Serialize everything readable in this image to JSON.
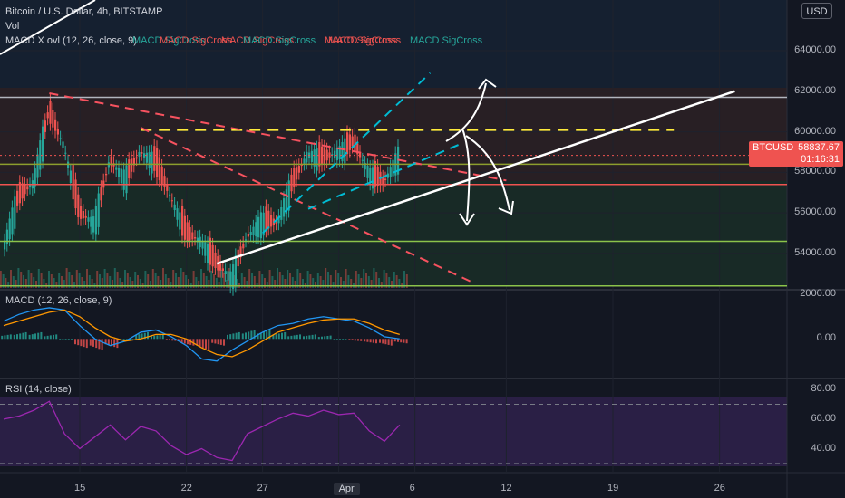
{
  "header": {
    "symbol_title": "Bitcoin / U.S. Dollar, 4h, BITSTAMP",
    "vol_label": "Vol",
    "indicator_label": "MACD X ovl (12, 26, close, 9)",
    "crossover_labels": [
      "MACD SigCross",
      "MACD SigCross",
      "MACD SigCross",
      "MACD SigCross",
      "MACD SigCross",
      "MACD SigCross",
      "MACD SigCross"
    ]
  },
  "currency_button": "USD",
  "price_tag": {
    "symbol": "BTCUSD",
    "price": "58837.67",
    "countdown": "01:16:31"
  },
  "panes": {
    "macd_label": "MACD (12, 26, close, 9)",
    "rsi_label": "RSI (14, close)"
  },
  "colors": {
    "background": "#131722",
    "up": "#26a69a",
    "down": "#ef5350",
    "trend_red": "#f7525f",
    "channel_cyan": "#00bcd4",
    "resistance_yellow": "#ffeb3b",
    "support_white": "#ffffff",
    "macd_line": "#2196f3",
    "signal_line": "#ff9800",
    "rsi_line": "#9c27b0"
  },
  "chart_data": [
    {
      "type": "line",
      "title": "Bitcoin / U.S. Dollar, 4h, BITSTAMP",
      "ylabel": "USD",
      "x_ticks": [
        "15",
        "22",
        "27",
        "Apr",
        "6",
        "12",
        "19",
        "26"
      ],
      "y_ticks": [
        54000,
        56000,
        58000,
        60000,
        62000,
        64000
      ],
      "ylim": [
        52300,
        66500
      ],
      "x_range": [
        "Mar 10",
        "Apr 27"
      ],
      "series": [
        {
          "type": "candlestick-approx",
          "x": [
            "Mar 10",
            "Mar 11",
            "Mar 12",
            "Mar 13",
            "Mar 14",
            "Mar 15",
            "Mar 16",
            "Mar 17",
            "Mar 18",
            "Mar 19",
            "Mar 20",
            "Mar 21",
            "Mar 22",
            "Mar 23",
            "Mar 24",
            "Mar 25",
            "Mar 26",
            "Mar 27",
            "Mar 28",
            "Mar 29",
            "Mar 30",
            "Mar 31",
            "Apr 1",
            "Apr 2",
            "Apr 3",
            "Apr 4",
            "Apr 5"
          ],
          "close": [
            54200,
            56800,
            57500,
            61000,
            59300,
            56000,
            55500,
            58600,
            57700,
            59000,
            58500,
            56800,
            55000,
            54600,
            53500,
            52800,
            54800,
            55600,
            55500,
            57500,
            58900,
            58700,
            59000,
            59500,
            58000,
            57500,
            58838
          ]
        }
      ],
      "horizontal_levels": [
        {
          "price": 61700,
          "color": "#b2b5be",
          "style": "solid"
        },
        {
          "price": 60100,
          "color": "#ffeb3b",
          "style": "dashed"
        },
        {
          "price": 58400,
          "color": "#8d9e2d",
          "style": "solid"
        },
        {
          "price": 57400,
          "color": "#ef5350",
          "style": "solid"
        },
        {
          "price": 54600,
          "color": "#8bc34a",
          "style": "solid"
        },
        {
          "price": 52400,
          "color": "#8bc34a",
          "style": "solid"
        }
      ],
      "trendlines": [
        {
          "from": [
            "Mar 13",
            61900
          ],
          "to": [
            "Apr 12",
            57600
          ],
          "color": "#f7525f",
          "style": "dashed"
        },
        {
          "from": [
            "Mar 19",
            60200
          ],
          "to": [
            "Apr 10",
            52500
          ],
          "color": "#f7525f",
          "style": "dashed"
        },
        {
          "from": [
            "Mar 24",
            53500
          ],
          "to": [
            "Apr 27",
            62000
          ],
          "color": "#ffffff",
          "style": "solid"
        },
        {
          "from": [
            "Mar 27",
            55000
          ],
          "to": [
            "Apr 7",
            62900
          ],
          "color": "#00bcd4",
          "style": "dashed"
        },
        {
          "from": [
            "Mar 30",
            56200
          ],
          "to": [
            "Apr 9",
            59400
          ],
          "color": "#00bcd4",
          "style": "dashed"
        }
      ]
    },
    {
      "type": "line",
      "title": "MACD (12, 26, close, 9)",
      "y_ticks": [
        0,
        2000
      ],
      "ylim": [
        -1700,
        2050
      ],
      "x": [
        "Mar 10",
        "Mar 11",
        "Mar 12",
        "Mar 13",
        "Mar 14",
        "Mar 15",
        "Mar 16",
        "Mar 17",
        "Mar 18",
        "Mar 19",
        "Mar 20",
        "Mar 21",
        "Mar 22",
        "Mar 23",
        "Mar 24",
        "Mar 25",
        "Mar 26",
        "Mar 27",
        "Mar 28",
        "Mar 29",
        "Mar 30",
        "Mar 31",
        "Apr 1",
        "Apr 2",
        "Apr 3",
        "Apr 4",
        "Apr 5"
      ],
      "series": [
        {
          "name": "MACD",
          "values": [
            800,
            1100,
            1300,
            1400,
            1300,
            600,
            0,
            -300,
            -100,
            300,
            400,
            100,
            -300,
            -900,
            -1000,
            -500,
            -100,
            300,
            600,
            700,
            900,
            1000,
            900,
            800,
            500,
            100,
            0
          ]
        },
        {
          "name": "Signal",
          "values": [
            600,
            800,
            1000,
            1200,
            1300,
            1000,
            500,
            100,
            -100,
            0,
            200,
            200,
            0,
            -400,
            -700,
            -800,
            -500,
            -100,
            300,
            500,
            700,
            850,
            900,
            900,
            700,
            400,
            200
          ]
        }
      ]
    },
    {
      "type": "line",
      "title": "RSI (14, close)",
      "y_ticks": [
        40,
        60,
        80
      ],
      "ylim": [
        25,
        85
      ],
      "bands": [
        30,
        70
      ],
      "x": [
        "Mar 10",
        "Mar 11",
        "Mar 12",
        "Mar 13",
        "Mar 14",
        "Mar 15",
        "Mar 16",
        "Mar 17",
        "Mar 18",
        "Mar 19",
        "Mar 20",
        "Mar 21",
        "Mar 22",
        "Mar 23",
        "Mar 24",
        "Mar 25",
        "Mar 26",
        "Mar 27",
        "Mar 28",
        "Mar 29",
        "Mar 30",
        "Mar 31",
        "Apr 1",
        "Apr 2",
        "Apr 3",
        "Apr 4",
        "Apr 5"
      ],
      "series": [
        {
          "name": "RSI",
          "values": [
            60,
            62,
            66,
            72,
            50,
            40,
            48,
            56,
            46,
            55,
            52,
            42,
            36,
            40,
            34,
            32,
            50,
            55,
            60,
            64,
            62,
            66,
            63,
            64,
            52,
            45,
            56
          ]
        }
      ]
    }
  ]
}
